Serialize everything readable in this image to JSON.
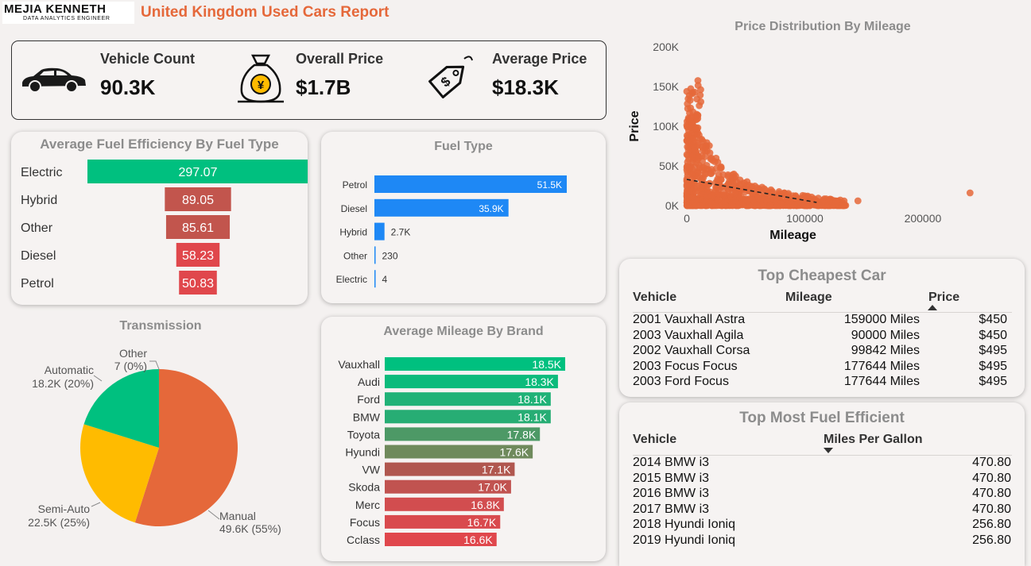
{
  "header": {
    "logo_main": "MEJIA KENNETH",
    "logo_sub": "DATA ANALYTICS ENGINEER",
    "title": "United Kingdom Used Cars Report"
  },
  "kpis": [
    {
      "label": "Vehicle Count",
      "value": "90.3K",
      "icon": "car-icon"
    },
    {
      "label": "Overall Price",
      "value": "$1.7B",
      "icon": "money-bag-icon"
    },
    {
      "label": "Average Price",
      "value": "$18.3K",
      "icon": "price-tag-icon"
    }
  ],
  "colors": {
    "accent": "#e5683a",
    "green": "#00c07f",
    "blue": "#1e88f5",
    "yellow": "#ffbb00",
    "red": "#e0474c"
  },
  "chart_data": [
    {
      "id": "fuel_efficiency",
      "type": "bar",
      "title": "Average Fuel Efficiency By Fuel Type",
      "categories": [
        "Electric",
        "Hybrid",
        "Other",
        "Diesel",
        "Petrol"
      ],
      "values": [
        297.07,
        89.05,
        85.61,
        58.23,
        50.83
      ],
      "labels": [
        "297.07",
        "89.05",
        "85.61",
        "58.23",
        "50.83"
      ],
      "colors": [
        "#00c07f",
        "#c2554d",
        "#c2554d",
        "#e0474c",
        "#e0474c"
      ]
    },
    {
      "id": "fuel_type",
      "type": "bar",
      "title": "Fuel Type",
      "categories": [
        "Petrol",
        "Diesel",
        "Hybrid",
        "Other",
        "Electric"
      ],
      "values": [
        51500,
        35900,
        2700,
        230,
        4
      ],
      "labels": [
        "51.5K",
        "35.9K",
        "2.7K",
        "230",
        "4"
      ]
    },
    {
      "id": "mileage_by_brand",
      "type": "bar",
      "title": "Average Mileage By Brand",
      "categories": [
        "Vauxhall",
        "Audi",
        "Ford",
        "BMW",
        "Toyota",
        "Hyundi",
        "VW",
        "Skoda",
        "Merc",
        "Focus",
        "Cclass"
      ],
      "values": [
        18500,
        18300,
        18100,
        18100,
        17800,
        17600,
        17100,
        17000,
        16800,
        16700,
        16600
      ],
      "labels": [
        "18.5K",
        "18.3K",
        "18.1K",
        "18.1K",
        "17.8K",
        "17.6K",
        "17.1K",
        "17.0K",
        "16.8K",
        "16.7K",
        "16.6K"
      ],
      "colors": [
        "#00c07f",
        "#0cbb7c",
        "#20b277",
        "#27ad74",
        "#4d9966",
        "#6f8a5c",
        "#b0574f",
        "#c15350",
        "#d24d4f",
        "#d94a4e",
        "#e0474c"
      ]
    },
    {
      "id": "transmission",
      "type": "pie",
      "title": "Transmission",
      "slices": [
        {
          "name": "Manual",
          "value": 49600,
          "label": "49.6K (55%)",
          "color": "#e5683a"
        },
        {
          "name": "Semi-Auto",
          "value": 22500,
          "label": "22.5K (25%)",
          "color": "#ffbb00"
        },
        {
          "name": "Automatic",
          "value": 18200,
          "label": "18.2K (20%)",
          "color": "#00c07f"
        },
        {
          "name": "Other",
          "value": 7,
          "label": "7 (0%)",
          "color": "#888888"
        }
      ]
    },
    {
      "id": "price_vs_mileage",
      "type": "scatter",
      "title": "Price Distribution By Mileage",
      "xlabel": "Mileage",
      "ylabel": "Price",
      "xlim": [
        0,
        260000
      ],
      "ylim": [
        0,
        200000
      ],
      "xticks": [
        "0",
        "100000",
        "200000"
      ],
      "yticks": [
        "0K",
        "50K",
        "100K",
        "150K",
        "200K"
      ],
      "trend": [
        [
          0,
          33000
        ],
        [
          110000,
          4000
        ]
      ],
      "outliers": [
        [
          240000,
          16000
        ],
        [
          145000,
          6000
        ]
      ],
      "color": "#e5683a"
    }
  ],
  "cheapest": {
    "title": "Top Cheapest Car",
    "headers": [
      "Vehicle",
      "Mileage",
      "Price"
    ],
    "rows": [
      [
        "2001 Vauxhall Astra",
        "159000 Miles",
        "$450"
      ],
      [
        "2003 Vauxhall Agila",
        "90000 Miles",
        "$450"
      ],
      [
        "2002 Vauxhall Corsa",
        "99842 Miles",
        "$495"
      ],
      [
        "2003 Focus Focus",
        "177644 Miles",
        "$495"
      ],
      [
        "2003 Ford Focus",
        "177644 Miles",
        "$495"
      ]
    ]
  },
  "efficient": {
    "title": "Top Most Fuel Efficient",
    "headers": [
      "Vehicle",
      "Miles Per Gallon"
    ],
    "rows": [
      [
        "2014 BMW i3",
        "470.80"
      ],
      [
        "2015 BMW i3",
        "470.80"
      ],
      [
        "2016 BMW i3",
        "470.80"
      ],
      [
        "2017 BMW i3",
        "470.80"
      ],
      [
        "2018 Hyundi Ioniq",
        "256.80"
      ],
      [
        "2019 Hyundi Ioniq",
        "256.80"
      ]
    ]
  }
}
